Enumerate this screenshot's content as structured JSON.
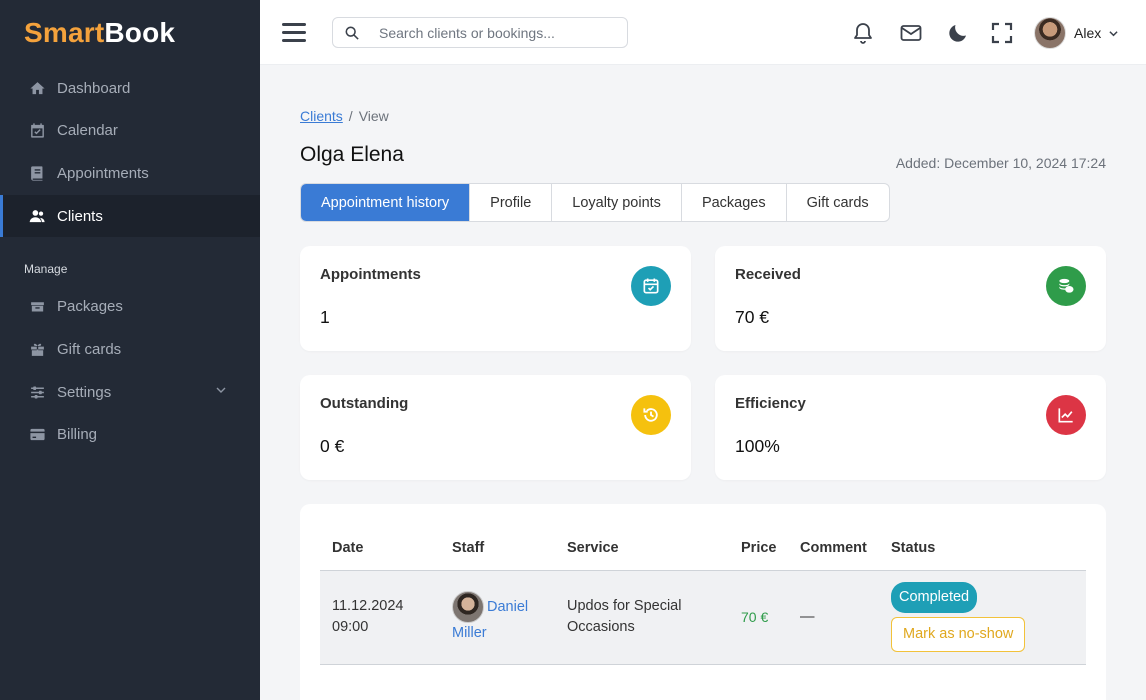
{
  "brand": {
    "part1": "Smart",
    "part2": "Book"
  },
  "sidebar": {
    "items": [
      {
        "label": "Dashboard",
        "icon": "home-icon"
      },
      {
        "label": "Calendar",
        "icon": "calendar-icon"
      },
      {
        "label": "Appointments",
        "icon": "book-icon"
      },
      {
        "label": "Clients",
        "icon": "users-icon",
        "active": true
      }
    ],
    "section_label": "Manage",
    "manage_items": [
      {
        "label": "Packages",
        "icon": "package-icon"
      },
      {
        "label": "Gift cards",
        "icon": "gift-icon"
      },
      {
        "label": "Settings",
        "icon": "sliders-icon",
        "has_chevron": true
      },
      {
        "label": "Billing",
        "icon": "credit-card-icon"
      }
    ]
  },
  "topbar": {
    "search_placeholder": "Search clients or bookings...",
    "user_name": "Alex"
  },
  "breadcrumb": {
    "link": "Clients",
    "separator": "/",
    "current": "View"
  },
  "page": {
    "title": "Olga Elena",
    "added": "Added: December 10, 2024 17:24"
  },
  "tabs": [
    {
      "label": "Appointment history",
      "active": true
    },
    {
      "label": "Profile"
    },
    {
      "label": "Loyalty points"
    },
    {
      "label": "Packages"
    },
    {
      "label": "Gift cards"
    }
  ],
  "stats": [
    {
      "label": "Appointments",
      "value": "1",
      "icon": "calendar-check-icon",
      "color": "#1e9fb6"
    },
    {
      "label": "Received",
      "value": "70 €",
      "icon": "coins-icon",
      "color": "#2f9c4a"
    },
    {
      "label": "Outstanding",
      "value": "0 €",
      "icon": "history-icon",
      "color": "#f5c10e"
    },
    {
      "label": "Efficiency",
      "value": "100%",
      "icon": "chart-line-icon",
      "color": "#dc3545"
    }
  ],
  "table": {
    "headers": [
      "Date",
      "Staff",
      "Service",
      "Price",
      "Comment",
      "Status"
    ],
    "rows": [
      {
        "date": "11.12.2024",
        "time": "09:00",
        "staff_first": "Daniel",
        "staff_last": "Miller",
        "service": "Updos for Special Occasions",
        "price": "70 €",
        "comment": "—",
        "status": "Completed",
        "action": "Mark as no-show"
      }
    ]
  },
  "colors": {
    "accent": "#3a7bd5",
    "sidebar_bg": "#232a36",
    "brand_orange": "#f4a23c"
  }
}
